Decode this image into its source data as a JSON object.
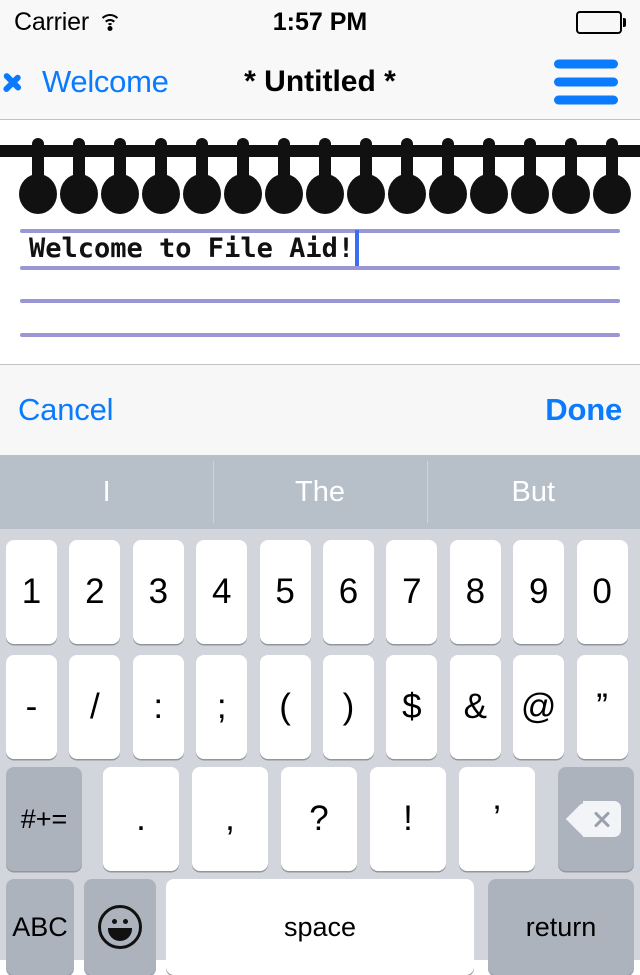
{
  "status_bar": {
    "carrier": "Carrier",
    "wifi_icon": "wifi-icon",
    "time": "1:57 PM",
    "battery_icon": "battery-full-icon"
  },
  "nav_bar": {
    "back_icon": "chevron-left-icon",
    "back_label": "Welcome",
    "title": "* Untitled *",
    "menu_icon": "hamburger-menu-icon",
    "accent_color": "#0a7bff"
  },
  "editor": {
    "spiral_icon": "spiral-binding-icon",
    "spiral_ring_count": 15,
    "text": "Welcome to File Aid!",
    "rule_line_color": "#9b97d4",
    "rule_line_count": 4,
    "caret_color": "#3a6df0"
  },
  "accessory_toolbar": {
    "cancel_label": "Cancel",
    "done_label": "Done"
  },
  "predictive_bar": {
    "suggestions": [
      "I",
      "The",
      "But"
    ]
  },
  "keyboard": {
    "rows": [
      {
        "name": "number-row",
        "keys": [
          {
            "label": "1",
            "name": "key-1",
            "style": "light"
          },
          {
            "label": "2",
            "name": "key-2",
            "style": "light"
          },
          {
            "label": "3",
            "name": "key-3",
            "style": "light"
          },
          {
            "label": "4",
            "name": "key-4",
            "style": "light"
          },
          {
            "label": "5",
            "name": "key-5",
            "style": "light"
          },
          {
            "label": "6",
            "name": "key-6",
            "style": "light"
          },
          {
            "label": "7",
            "name": "key-7",
            "style": "light"
          },
          {
            "label": "8",
            "name": "key-8",
            "style": "light"
          },
          {
            "label": "9",
            "name": "key-9",
            "style": "light"
          },
          {
            "label": "0",
            "name": "key-0",
            "style": "light"
          }
        ]
      },
      {
        "name": "symbol-row",
        "keys": [
          {
            "label": "-",
            "name": "key-hyphen",
            "style": "light"
          },
          {
            "label": "/",
            "name": "key-slash",
            "style": "light"
          },
          {
            "label": ":",
            "name": "key-colon",
            "style": "light"
          },
          {
            "label": ";",
            "name": "key-semicolon",
            "style": "light"
          },
          {
            "label": "(",
            "name": "key-paren-open",
            "style": "light"
          },
          {
            "label": ")",
            "name": "key-paren-close",
            "style": "light"
          },
          {
            "label": "$",
            "name": "key-dollar",
            "style": "light"
          },
          {
            "label": "&",
            "name": "key-ampersand",
            "style": "light"
          },
          {
            "label": "@",
            "name": "key-at",
            "style": "light"
          },
          {
            "label": "”",
            "name": "key-quote",
            "style": "light"
          }
        ]
      },
      {
        "name": "punctuation-row",
        "keys": [
          {
            "label": "#+=",
            "name": "key-symbols-shift",
            "style": "dark"
          },
          {
            "label": ".",
            "name": "key-period",
            "style": "light"
          },
          {
            "label": ",",
            "name": "key-comma",
            "style": "light"
          },
          {
            "label": "?",
            "name": "key-question",
            "style": "light"
          },
          {
            "label": "!",
            "name": "key-exclamation",
            "style": "light"
          },
          {
            "label": "’",
            "name": "key-apostrophe",
            "style": "light"
          },
          {
            "label": "",
            "name": "key-backspace",
            "style": "dark",
            "icon": "backspace-icon"
          }
        ]
      },
      {
        "name": "bottom-row",
        "keys": [
          {
            "label": "ABC",
            "name": "key-abc",
            "style": "dark"
          },
          {
            "label": "",
            "name": "key-emoji",
            "style": "dark",
            "icon": "emoji-smiley-icon"
          },
          {
            "label": "space",
            "name": "key-space",
            "style": "light"
          },
          {
            "label": "return",
            "name": "key-return",
            "style": "dark"
          }
        ]
      }
    ]
  }
}
